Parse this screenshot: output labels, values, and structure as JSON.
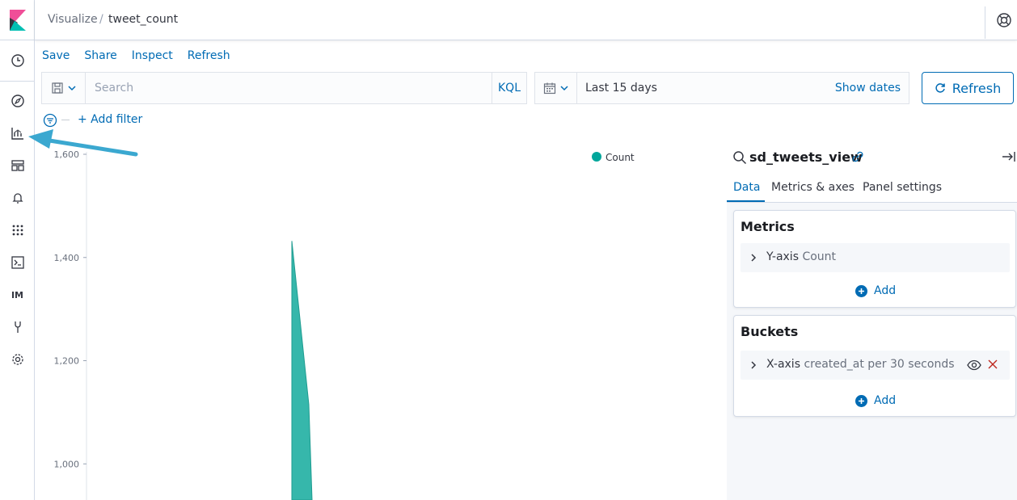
{
  "header": {
    "crumb_root": "Visualize",
    "crumb_sep": "/",
    "crumb_current": "tweet_count"
  },
  "topmenu": {
    "save": "Save",
    "share": "Share",
    "inspect": "Inspect",
    "refresh": "Refresh"
  },
  "query": {
    "placeholder": "Search",
    "language": "KQL"
  },
  "datepicker": {
    "range": "Last 15 days",
    "show_dates": "Show dates"
  },
  "refresh_button": "Refresh",
  "filter": {
    "add_filter": "+ Add filter"
  },
  "sidenav": {
    "im_label": "IM",
    "items": [
      "clock-icon",
      "compass-icon",
      "visualize-icon",
      "dashboard-icon",
      "bell-icon",
      "apps-grid-icon",
      "console-icon",
      "im-app",
      "wrench-icon",
      "gear-icon"
    ]
  },
  "editor": {
    "index_pattern": "sd_tweets_view",
    "tabs": [
      "Data",
      "Metrics & axes",
      "Panel settings"
    ],
    "active_tab": "Data",
    "metrics": {
      "title": "Metrics",
      "agg_label": "Y-axis",
      "agg_desc": "Count",
      "add": "Add"
    },
    "buckets": {
      "title": "Buckets",
      "agg_label": "X-axis",
      "agg_desc": "created_at per 30 seconds",
      "add": "Add"
    }
  },
  "colors": {
    "accent": "#006bb4",
    "series": "#36b7ab",
    "series_dot": "#00a69b",
    "annotation_arrow": "#3ba8d0"
  },
  "chart_data": {
    "type": "area",
    "yticks": [
      1000,
      1200,
      1400,
      1600
    ],
    "ytick_labels": [
      "1,000",
      "1,200",
      "1,400",
      "1,600"
    ],
    "ylim": [
      930,
      1600
    ],
    "legend": [
      "Count"
    ],
    "legend_position": "top-right",
    "series": [
      {
        "name": "Count",
        "points": [
          {
            "x": 0,
            "y": 930
          },
          {
            "x": 1,
            "y": 1432
          },
          {
            "x": 2,
            "y": 1115
          },
          {
            "x": 3,
            "y": 930
          }
        ]
      }
    ]
  }
}
